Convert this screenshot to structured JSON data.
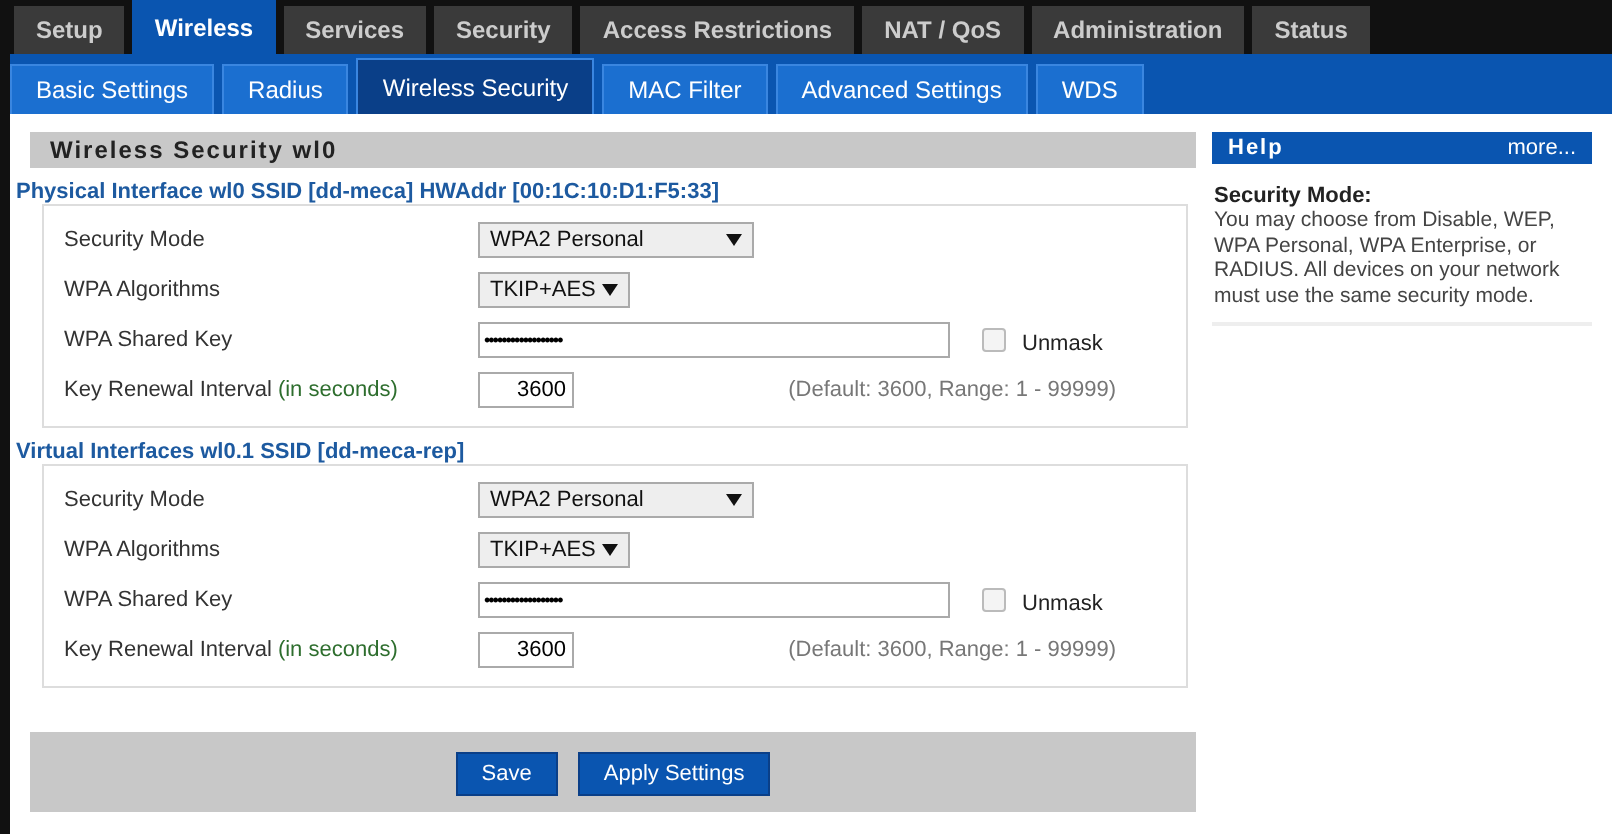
{
  "main_tabs": [
    {
      "label": "Setup",
      "selected": false
    },
    {
      "label": "Wireless",
      "selected": true
    },
    {
      "label": "Services",
      "selected": false
    },
    {
      "label": "Security",
      "selected": false
    },
    {
      "label": "Access Restrictions",
      "selected": false
    },
    {
      "label": "NAT / QoS",
      "selected": false
    },
    {
      "label": "Administration",
      "selected": false
    },
    {
      "label": "Status",
      "selected": false
    }
  ],
  "sub_tabs": [
    {
      "label": "Basic Settings",
      "selected": false
    },
    {
      "label": "Radius",
      "selected": false
    },
    {
      "label": "Wireless Security",
      "selected": true
    },
    {
      "label": "MAC Filter",
      "selected": false
    },
    {
      "label": "Advanced Settings",
      "selected": false
    },
    {
      "label": "WDS",
      "selected": false
    }
  ],
  "panel_title": "Wireless Security wl0",
  "sections": [
    {
      "legend": "Physical Interface wl0 SSID [dd-meca] HWAddr [00:1C:10:D1:F5:33]",
      "rows": [
        {
          "kind": "select",
          "label": "Security Mode",
          "value": "WPA2 Personal",
          "wide": true
        },
        {
          "kind": "select",
          "label": "WPA Algorithms",
          "value": "TKIP+AES",
          "wide": false
        },
        {
          "kind": "password",
          "label": "WPA Shared Key",
          "value": "••••••••••••••••••",
          "unmask_label": "Unmask",
          "unmask_checked": false
        },
        {
          "kind": "number",
          "label": "Key Renewal Interval",
          "label_note": "(in seconds)",
          "value": "3600",
          "hint": "(Default: 3600, Range: 1 - 99999)"
        }
      ]
    },
    {
      "legend": "Virtual Interfaces wl0.1 SSID [dd-meca-rep]",
      "rows": [
        {
          "kind": "select",
          "label": "Security Mode",
          "value": "WPA2 Personal",
          "wide": true
        },
        {
          "kind": "select",
          "label": "WPA Algorithms",
          "value": "TKIP+AES",
          "wide": false
        },
        {
          "kind": "password",
          "label": "WPA Shared Key",
          "value": "••••••••••••••••••",
          "unmask_label": "Unmask",
          "unmask_checked": false
        },
        {
          "kind": "number",
          "label": "Key Renewal Interval",
          "label_note": "(in seconds)",
          "value": "3600",
          "hint": "(Default: 3600, Range: 1 - 99999)"
        }
      ]
    }
  ],
  "buttons": [
    "Save",
    "Apply Settings"
  ],
  "help": {
    "title": "Help",
    "more": "more...",
    "heading": "Security Mode:",
    "text": "You may choose from Disable, WEP, WPA Personal, WPA Enterprise, or RADIUS. All devices on your network must use the same security mode."
  }
}
